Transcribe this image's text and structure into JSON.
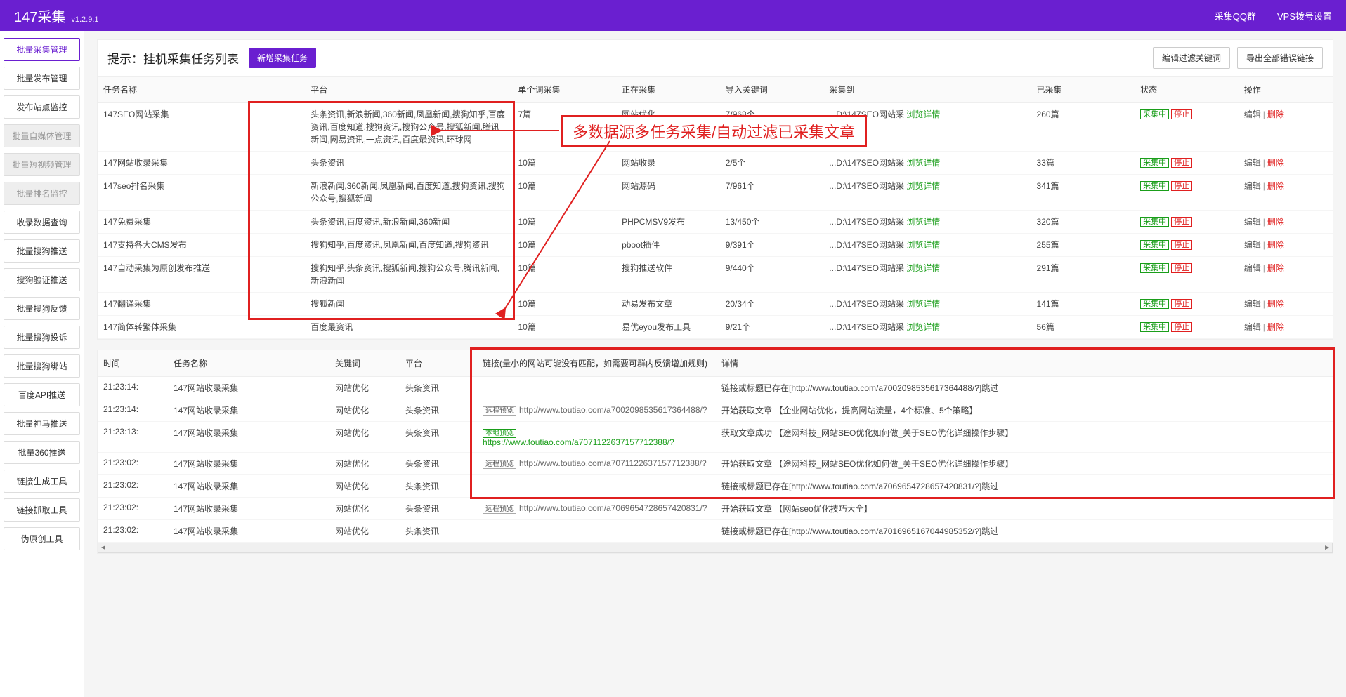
{
  "header": {
    "title": "147采集",
    "version": "v1.2.9.1",
    "qq": "采集QQ群",
    "vps": "VPS拨号设置"
  },
  "sidebar": [
    {
      "label": "批量采集管理",
      "state": "active"
    },
    {
      "label": "批量发布管理",
      "state": ""
    },
    {
      "label": "发布站点监控",
      "state": ""
    },
    {
      "label": "批量自媒体管理",
      "state": "disabled"
    },
    {
      "label": "批量短视频管理",
      "state": "disabled"
    },
    {
      "label": "批量排名监控",
      "state": "disabled"
    },
    {
      "label": "收录数据查询",
      "state": ""
    },
    {
      "label": "批量搜狗推送",
      "state": ""
    },
    {
      "label": "搜狗验证推送",
      "state": ""
    },
    {
      "label": "批量搜狗反馈",
      "state": ""
    },
    {
      "label": "批量搜狗投诉",
      "state": ""
    },
    {
      "label": "批量搜狗绑站",
      "state": ""
    },
    {
      "label": "百度API推送",
      "state": ""
    },
    {
      "label": "批量神马推送",
      "state": ""
    },
    {
      "label": "批量360推送",
      "state": ""
    },
    {
      "label": "链接生成工具",
      "state": ""
    },
    {
      "label": "链接抓取工具",
      "state": ""
    },
    {
      "label": "伪原创工具",
      "state": ""
    }
  ],
  "tasks": {
    "title": "提示：挂机采集任务列表",
    "new_btn": "新增采集任务",
    "filter_btn": "编辑过滤关键词",
    "export_btn": "导出全部错误链接",
    "headers": {
      "name": "任务名称",
      "platform": "平台",
      "perword": "单个词采集",
      "collecting": "正在采集",
      "imported": "导入关键词",
      "saveto": "采集到",
      "collected": "已采集",
      "status": "状态",
      "ops": "操作"
    },
    "rows": [
      {
        "name": "147SEO网站采集",
        "platform": "头条资讯,新浪新闻,360新闻,凤凰新闻,搜狗知乎,百度资讯,百度知道,搜狗资讯,搜狗公众号,搜狐新闻,腾讯新闻,网易资讯,一点资讯,百度最资讯,环球网",
        "perword": "7篇",
        "collecting": "网站优化",
        "imported": "7/968个",
        "saveto": "...D:\\147SEO网站采",
        "detail": "浏览详情",
        "collected": "260篇",
        "status": "采集中",
        "stop": "停止",
        "edit": "编辑",
        "del": "删除"
      },
      {
        "name": "147网站收录采集",
        "platform": "头条资讯",
        "perword": "10篇",
        "collecting": "网站收录",
        "imported": "2/5个",
        "saveto": "...D:\\147SEO网站采",
        "detail": "浏览详情",
        "collected": "33篇",
        "status": "采集中",
        "stop": "停止",
        "edit": "编辑",
        "del": "删除"
      },
      {
        "name": "147seo排名采集",
        "platform": "新浪新闻,360新闻,凤凰新闻,百度知道,搜狗资讯,搜狗公众号,搜狐新闻",
        "perword": "10篇",
        "collecting": "网站源码",
        "imported": "7/961个",
        "saveto": "...D:\\147SEO网站采",
        "detail": "浏览详情",
        "collected": "341篇",
        "status": "采集中",
        "stop": "停止",
        "edit": "编辑",
        "del": "删除"
      },
      {
        "name": "147免费采集",
        "platform": "头条资讯,百度资讯,新浪新闻,360新闻",
        "perword": "10篇",
        "collecting": "PHPCMSV9发布",
        "imported": "13/450个",
        "saveto": "...D:\\147SEO网站采",
        "detail": "浏览详情",
        "collected": "320篇",
        "status": "采集中",
        "stop": "停止",
        "edit": "编辑",
        "del": "删除"
      },
      {
        "name": "147支持各大CMS发布",
        "platform": "搜狗知乎,百度资讯,凤凰新闻,百度知道,搜狗资讯",
        "perword": "10篇",
        "collecting": "pboot插件",
        "imported": "9/391个",
        "saveto": "...D:\\147SEO网站采",
        "detail": "浏览详情",
        "collected": "255篇",
        "status": "采集中",
        "stop": "停止",
        "edit": "编辑",
        "del": "删除"
      },
      {
        "name": "147自动采集为原创发布推送",
        "platform": "搜狗知乎,头条资讯,搜狐新闻,搜狗公众号,腾讯新闻,新浪新闻",
        "perword": "10篇",
        "collecting": "搜狗推送软件",
        "imported": "9/440个",
        "saveto": "...D:\\147SEO网站采",
        "detail": "浏览详情",
        "collected": "291篇",
        "status": "采集中",
        "stop": "停止",
        "edit": "编辑",
        "del": "删除"
      },
      {
        "name": "147翻译采集",
        "platform": "搜狐新闻",
        "perword": "10篇",
        "collecting": "动易发布文章",
        "imported": "20/34个",
        "saveto": "...D:\\147SEO网站采",
        "detail": "浏览详情",
        "collected": "141篇",
        "status": "采集中",
        "stop": "停止",
        "edit": "编辑",
        "del": "删除"
      },
      {
        "name": "147简体转繁体采集",
        "platform": "百度最资讯",
        "perword": "10篇",
        "collecting": "易优eyou发布工具",
        "imported": "9/21个",
        "saveto": "...D:\\147SEO网站采",
        "detail": "浏览详情",
        "collected": "56篇",
        "status": "采集中",
        "stop": "停止",
        "edit": "编辑",
        "del": "删除"
      }
    ]
  },
  "log": {
    "headers": {
      "time": "时间",
      "name": "任务名称",
      "keyword": "关键词",
      "platform": "平台",
      "link": "链接(量小的网站可能没有匹配，如需要可群内反馈增加规则)",
      "detail": "详情"
    },
    "rows": [
      {
        "time": "21:23:14:",
        "name": "147网站收录采集",
        "keyword": "网站优化",
        "platform": "头条资讯",
        "link_type": "",
        "link": "",
        "detail": "链接或标题已存在[http://www.toutiao.com/a7002098535617364488/?]跳过"
      },
      {
        "time": "21:23:14:",
        "name": "147网站收录采集",
        "keyword": "网站优化",
        "platform": "头条资讯",
        "link_type": "remote",
        "link_btn": "远程预览",
        "link": "http://www.toutiao.com/a7002098535617364488/?",
        "detail": "开始获取文章 【企业网站优化，提高网站流量，4个标准、5个策略】"
      },
      {
        "time": "21:23:13:",
        "name": "147网站收录采集",
        "keyword": "网站优化",
        "platform": "头条资讯",
        "link_type": "local",
        "link_btn": "本地预览",
        "link": "https://www.toutiao.com/a7071122637157712388/?",
        "detail": "获取文章成功 【途网科技_网站SEO优化如何做_关于SEO优化详细操作步骤】"
      },
      {
        "time": "21:23:02:",
        "name": "147网站收录采集",
        "keyword": "网站优化",
        "platform": "头条资讯",
        "link_type": "remote",
        "link_btn": "远程预览",
        "link": "http://www.toutiao.com/a7071122637157712388/?",
        "detail": "开始获取文章 【途网科技_网站SEO优化如何做_关于SEO优化详细操作步骤】"
      },
      {
        "time": "21:23:02:",
        "name": "147网站收录采集",
        "keyword": "网站优化",
        "platform": "头条资讯",
        "link_type": "",
        "link": "",
        "detail": "链接或标题已存在[http://www.toutiao.com/a7069654728657420831/?]跳过"
      },
      {
        "time": "21:23:02:",
        "name": "147网站收录采集",
        "keyword": "网站优化",
        "platform": "头条资讯",
        "link_type": "remote",
        "link_btn": "远程预览",
        "link": "http://www.toutiao.com/a7069654728657420831/?",
        "detail": "开始获取文章 【网站seo优化技巧大全】"
      },
      {
        "time": "21:23:02:",
        "name": "147网站收录采集",
        "keyword": "网站优化",
        "platform": "头条资讯",
        "link_type": "",
        "link": "",
        "detail": "链接或标题已存在[http://www.toutiao.com/a7016965167044985352/?]跳过"
      }
    ]
  },
  "annotation": "多数据源多任务采集/自动过滤已采集文章"
}
